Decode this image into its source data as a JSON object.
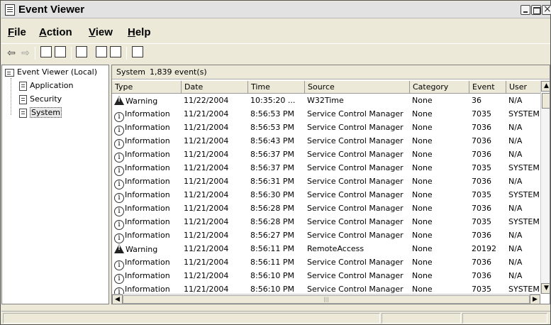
{
  "window": {
    "title": "Event Viewer"
  },
  "menu": {
    "file": "File",
    "action": "Action",
    "view": "View",
    "help": "Help"
  },
  "tree": {
    "root": "Event Viewer (Local)",
    "items": [
      "Application",
      "Security",
      "System"
    ],
    "selected": "System"
  },
  "pane": {
    "name": "System",
    "count": "1,839 event(s)"
  },
  "columns": [
    "Type",
    "Date",
    "Time",
    "Source",
    "Category",
    "Event",
    "User"
  ],
  "rows": [
    {
      "type": "Warning",
      "date": "11/22/2004",
      "time": "10:35:20 ...",
      "source": "W32Time",
      "category": "None",
      "event": "36",
      "user": "N/A"
    },
    {
      "type": "Information",
      "date": "11/21/2004",
      "time": "8:56:53 PM",
      "source": "Service Control Manager",
      "category": "None",
      "event": "7035",
      "user": "SYSTEM"
    },
    {
      "type": "Information",
      "date": "11/21/2004",
      "time": "8:56:53 PM",
      "source": "Service Control Manager",
      "category": "None",
      "event": "7036",
      "user": "N/A"
    },
    {
      "type": "Information",
      "date": "11/21/2004",
      "time": "8:56:43 PM",
      "source": "Service Control Manager",
      "category": "None",
      "event": "7036",
      "user": "N/A"
    },
    {
      "type": "Information",
      "date": "11/21/2004",
      "time": "8:56:37 PM",
      "source": "Service Control Manager",
      "category": "None",
      "event": "7036",
      "user": "N/A"
    },
    {
      "type": "Information",
      "date": "11/21/2004",
      "time": "8:56:37 PM",
      "source": "Service Control Manager",
      "category": "None",
      "event": "7035",
      "user": "SYSTEM"
    },
    {
      "type": "Information",
      "date": "11/21/2004",
      "time": "8:56:31 PM",
      "source": "Service Control Manager",
      "category": "None",
      "event": "7036",
      "user": "N/A"
    },
    {
      "type": "Information",
      "date": "11/21/2004",
      "time": "8:56:30 PM",
      "source": "Service Control Manager",
      "category": "None",
      "event": "7035",
      "user": "SYSTEM"
    },
    {
      "type": "Information",
      "date": "11/21/2004",
      "time": "8:56:28 PM",
      "source": "Service Control Manager",
      "category": "None",
      "event": "7036",
      "user": "N/A"
    },
    {
      "type": "Information",
      "date": "11/21/2004",
      "time": "8:56:28 PM",
      "source": "Service Control Manager",
      "category": "None",
      "event": "7035",
      "user": "SYSTEM"
    },
    {
      "type": "Information",
      "date": "11/21/2004",
      "time": "8:56:27 PM",
      "source": "Service Control Manager",
      "category": "None",
      "event": "7036",
      "user": "N/A"
    },
    {
      "type": "Warning",
      "date": "11/21/2004",
      "time": "8:56:11 PM",
      "source": "RemoteAccess",
      "category": "None",
      "event": "20192",
      "user": "N/A"
    },
    {
      "type": "Information",
      "date": "11/21/2004",
      "time": "8:56:11 PM",
      "source": "Service Control Manager",
      "category": "None",
      "event": "7036",
      "user": "N/A"
    },
    {
      "type": "Information",
      "date": "11/21/2004",
      "time": "8:56:10 PM",
      "source": "Service Control Manager",
      "category": "None",
      "event": "7036",
      "user": "N/A"
    },
    {
      "type": "Information",
      "date": "11/21/2004",
      "time": "8:56:10 PM",
      "source": "Service Control Manager",
      "category": "None",
      "event": "7035",
      "user": "SYSTEM"
    }
  ],
  "icons": {
    "warning": "warning-icon",
    "information": "information-icon"
  }
}
